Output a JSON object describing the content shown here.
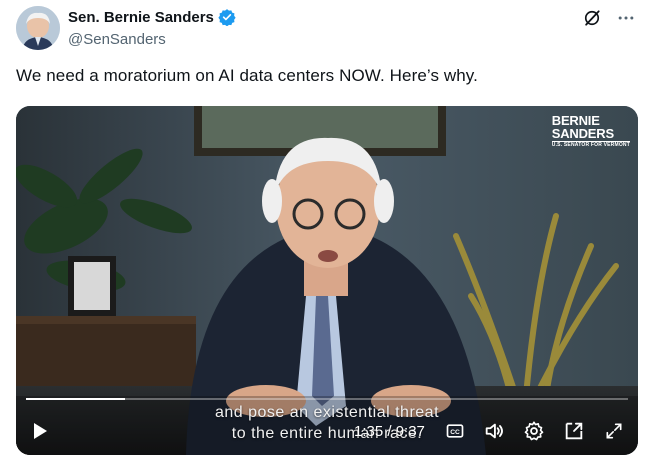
{
  "author": {
    "display_name": "Sen. Bernie Sanders",
    "handle": "@SenSanders"
  },
  "icons": {
    "verified": "verified-badge-icon",
    "grok": "grok-icon",
    "more": "more-options-icon"
  },
  "tweet": {
    "text": "We need a moratorium on AI data centers NOW. Here’s why."
  },
  "video": {
    "logo_line1": "BERNIE",
    "logo_line2": "SANDERS",
    "logo_sub": "U.S. SENATOR FOR VERMONT",
    "caption_line1": "and pose an existential threat",
    "caption_line2": "to the entire human race.",
    "time": "1:35 / 9:37",
    "progress": 0.165
  },
  "colors": {
    "verified_blue": "#1d9bf0",
    "handle_gray": "#536471"
  }
}
